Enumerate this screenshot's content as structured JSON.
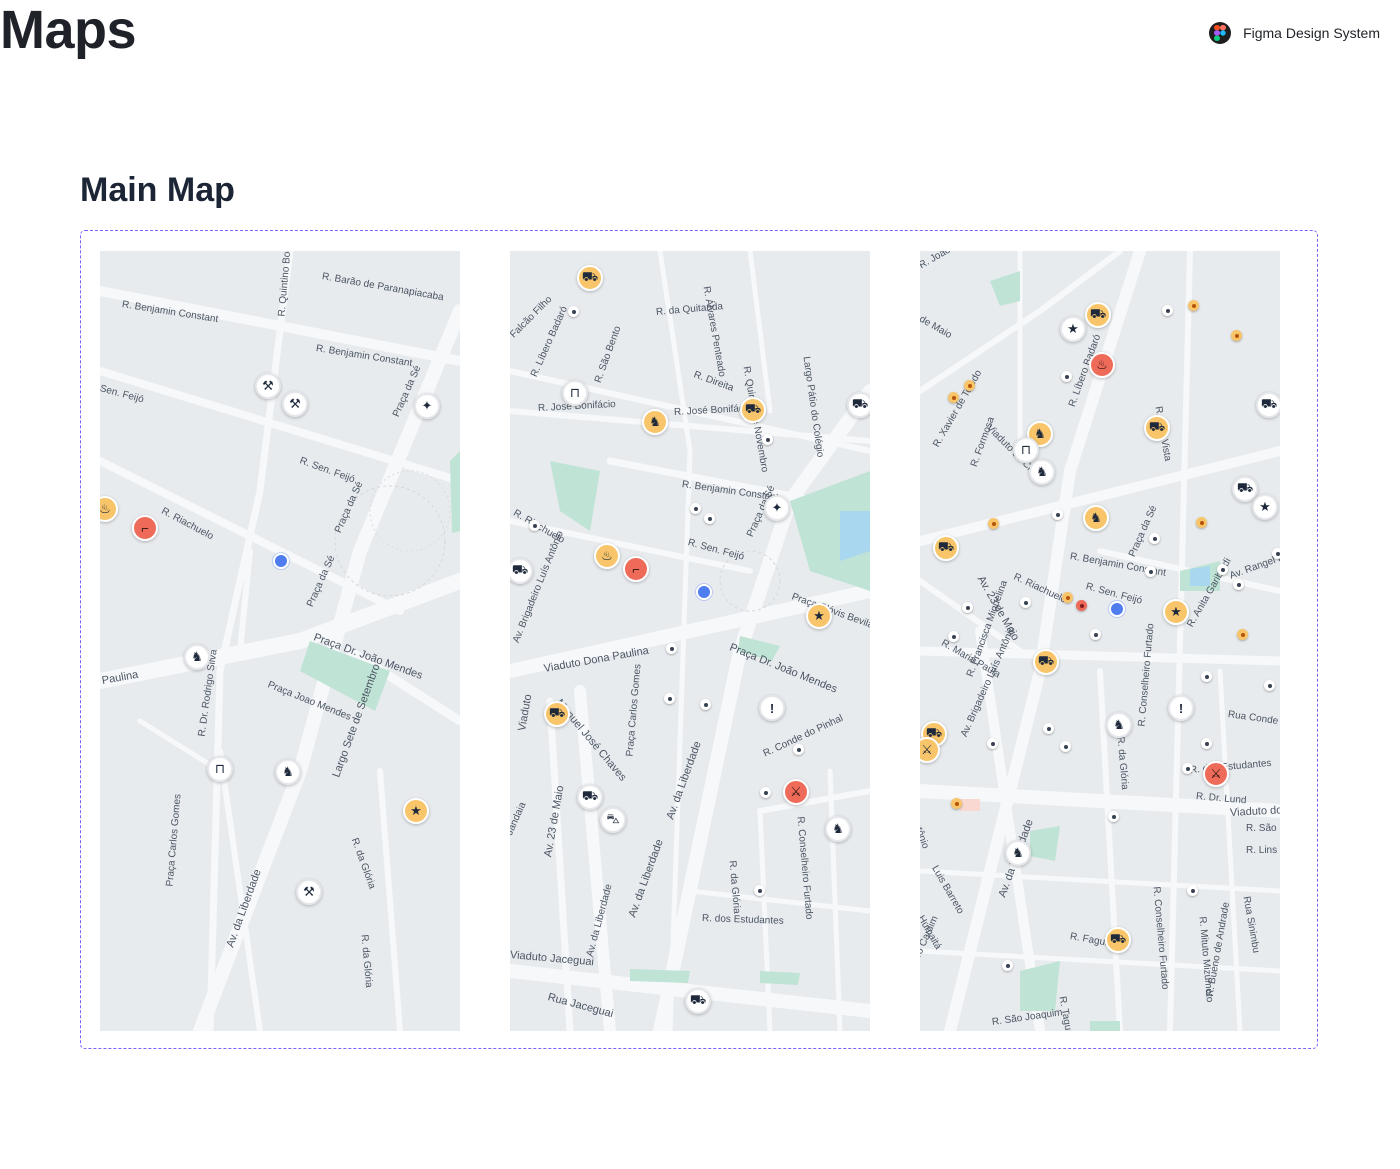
{
  "page": {
    "title": "Maps"
  },
  "brand": {
    "label": "Figma Design System"
  },
  "section": {
    "title": "Main Map"
  },
  "maps": [
    {
      "streets": [
        "R. Barão de Paranapiacaba",
        "R. Benjamin Constant",
        "R. Benjamin Constant",
        "R. Quintino Boc",
        "Sen. Feijó",
        "R. Sen. Feijó",
        "R. Riachuelo",
        "Praça da Sé",
        "Praça da Sé",
        "Praça da Sé",
        "Praça Dr. João Mendes",
        "Paulina",
        "Praça Joao Mendes",
        "R. Dr. Rodrigo Silva",
        "Largo Sete de Setembro",
        "R. da Glória",
        "Praça Carlos Gomes",
        "Av. da Liberdade",
        "R. da Glória"
      ]
    },
    {
      "streets": [
        "R. da Quitanda",
        "R. Álvares Penteado",
        "R. Quinze de Novembro",
        "Largo Pátio do Colégio",
        "R. Direita",
        "R. José Bonifácio",
        "R. José Bonifácio",
        "R. Benjamin Constant",
        "R. Líbero Badaró",
        "R. São Bento",
        "Falcão Filho",
        "R. Riachuelo",
        "R. Sen. Feijó",
        "Praça da Sé",
        "Viaduto Dona Paulina",
        "Praça Dr. João Mendes",
        "Praça Clóvis Bevilaqua",
        "Manuel José Chaves",
        "Av. Brigadeiro Luís Antônio",
        "Praça Carlos Gomes",
        "Av. da Liberdade",
        "R. Conde do Pinhal",
        "R. Conselheiro Furtado",
        "R. da Glória",
        "Viaduto",
        "R. Jandaia",
        "Av. 23 de Maio",
        "Av. da Liberdade",
        "R. dos Estudantes",
        "Viaduto Jaceguai",
        "Rua Jaceguai",
        "Av. da Liberdade"
      ]
    },
    {
      "streets": [
        "R. João",
        "de Maio",
        "R. Líbero Badaró",
        "R. Boa Vista",
        "Viaduto do Chá",
        "R. Xavier de Toledo",
        "R. Formosa",
        "R. Benjamin Constant",
        "R. Sen. Feijó",
        "R. Riachuelo",
        "Praça da Sé",
        "Av. 23 de Maio",
        "R. Maria Paula",
        "Av. Brigadeiro Luís Antônio",
        "R. Francisca Miquelina",
        "Av. Rangel Pestana",
        "R. Anita Garibaldi",
        "R. Conselheiro Furtado",
        "R. da Glória",
        "R. dos Estudantes",
        "Rua Conde de Sarzedas",
        "R. Dr. Lund",
        "Viaduto do Glicério",
        "R. São Paulo",
        "R. Lins",
        "Av. da Liberdade",
        "R. Fagundes",
        "R. Mituto Mizumoto",
        "R. Conselheiro Furtado",
        "Av. Maestro Cardim",
        "R. São Joaquim",
        "R. Bueno de Andrade",
        "Humaitá",
        "Luis Barreto",
        "Rua Sinimbu",
        "R. Tagua",
        "Antônio"
      ]
    }
  ],
  "colors": {
    "frame": "#7b61ff",
    "pin_yellow": "#f8c56a",
    "pin_red": "#ee6b5a",
    "user_location": "#4f7df0",
    "park": "#bfe3d4",
    "road": "#f6f8fa",
    "map_bg": "#e8ebee"
  },
  "icon_legend": [
    "wrench-screwdriver-icon",
    "robbery-icon",
    "car-crash-icon",
    "police-badge-icon",
    "gun-icon",
    "fire-icon",
    "barrier-icon",
    "alert-icon",
    "bus-icon",
    "assault-icon"
  ]
}
